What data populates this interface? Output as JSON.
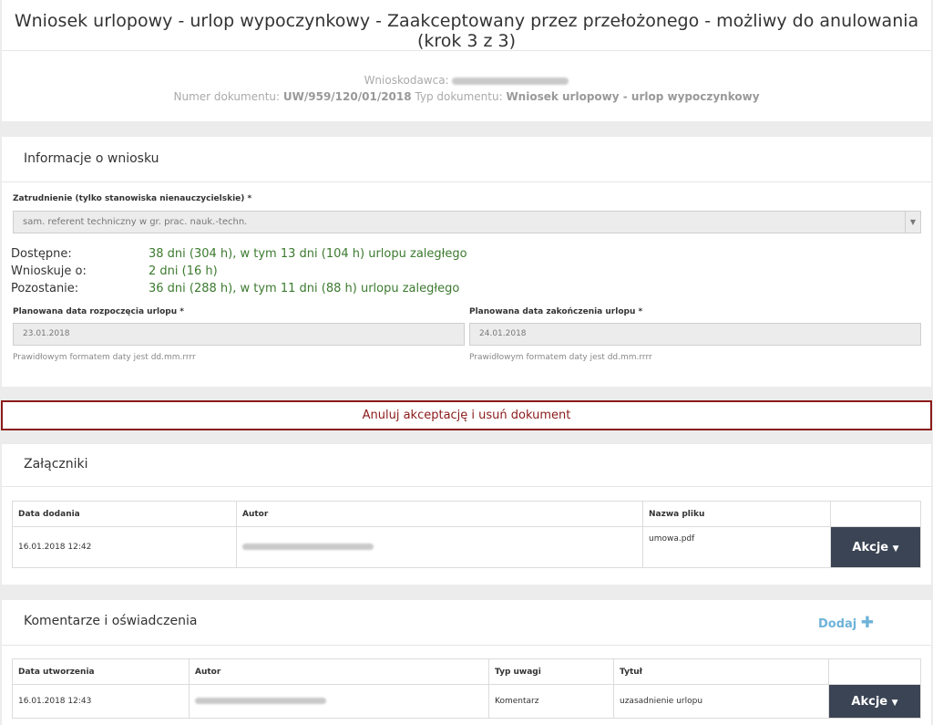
{
  "header": {
    "title": "Wniosek urlopowy - urlop wypoczynkowy - Zaakceptowany przez przełożonego - możliwy do anulowania (krok 3 z 3)",
    "applicant_label": "Wnioskodawca:",
    "docnum_label": "Numer dokumentu:",
    "docnum_value": "UW/959/120/01/2018",
    "doctype_label": "Typ dokumentu:",
    "doctype_value": "Wniosek urlopowy - urlop wypoczynkowy"
  },
  "info": {
    "heading": "Informacje o wniosku",
    "employment_label": "Zatrudnienie (tylko stanowiska nienauczycielskie) *",
    "employment_value": "sam. referent techniczny w gr. prac. nauk.-techn.",
    "available_label": "Dostępne:",
    "available_value": "38 dni (304 h), w tym 13 dni (104 h) urlopu zaległego",
    "requested_label": "Wnioskuje o:",
    "requested_value": "2 dni (16 h)",
    "remaining_label": "Pozostanie:",
    "remaining_value": "36 dni (288 h), w tym 11 dni (88 h) urlopu zaległego",
    "start_label": "Planowana data rozpoczęcia urlopu *",
    "start_value": "23.01.2018",
    "end_label": "Planowana data zakończenia urlopu *",
    "end_value": "24.01.2018",
    "date_hint": "Prawidłowym formatem daty jest dd.mm.rrrr"
  },
  "cancel_button": "Anuluj akceptację i usuń dokument",
  "attachments": {
    "heading": "Załączniki",
    "columns": [
      "Data dodania",
      "Autor",
      "Nazwa pliku"
    ],
    "row": {
      "date": "16.01.2018 12:42",
      "file": "umowa.pdf"
    },
    "action_label": "Akcje"
  },
  "comments": {
    "heading": "Komentarze i oświadczenia",
    "add_label": "Dodaj",
    "columns": [
      "Data utworzenia",
      "Autor",
      "Typ uwagi",
      "Tytuł"
    ],
    "row": {
      "date": "16.01.2018 12:43",
      "type": "Komentarz",
      "title": "uzasadnienie urlopu"
    },
    "action_label": "Akcje"
  }
}
